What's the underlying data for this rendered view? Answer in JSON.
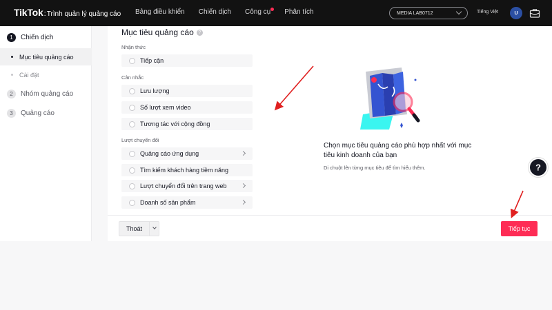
{
  "topbar": {
    "logo_main": "TikTok",
    "logo_colon": ":",
    "logo_sub": "Trình quản lý quảng cáo",
    "nav": [
      "Bảng điều khiển",
      "Chiến dịch",
      "Công cụ",
      "Phân tích"
    ],
    "account": "MEDIA LAB0712",
    "language": "Tiếng Việt",
    "avatar_initial": "U",
    "icons": {
      "account_dropdown": "chevron-down-icon",
      "briefcase": "briefcase-icon"
    },
    "notification_color": "#fe2c55"
  },
  "sidebar": {
    "steps": [
      {
        "num": "1",
        "label": "Chiến dịch"
      },
      {
        "num": "2",
        "label": "Nhóm quảng cáo"
      },
      {
        "num": "3",
        "label": "Quảng cáo"
      }
    ],
    "substeps": [
      {
        "label": "Mục tiêu quảng cáo"
      },
      {
        "label": "Cài đặt"
      }
    ]
  },
  "main": {
    "title": "Mục tiêu quảng cáo",
    "help_glyph": "?",
    "groups": {
      "awareness": "Nhận thức",
      "consideration": "Cân nhắc",
      "conversion": "Lượt chuyển đổi"
    },
    "options": {
      "reach": "Tiếp cận",
      "traffic": "Lưu lượng",
      "video_views": "Số lượt xem video",
      "community": "Tương tác với cộng đồng",
      "app_promotion": "Quảng cáo ứng dụng",
      "lead_gen": "Tìm kiếm khách hàng tiềm năng",
      "web_conversions": "Lượt chuyển đổi trên trang web",
      "product_sales": "Doanh số sản phẩm"
    },
    "promo_title": "Chọn mục tiêu quảng cáo phù hợp nhất với mục tiêu kinh doanh của bạn",
    "promo_sub": "Di chuột lên từng mục tiêu để tìm hiểu thêm.",
    "exit": "Thoát",
    "continue": "Tiếp tục"
  },
  "colors": {
    "accent": "#fe2c55",
    "annotation_arrow": "#e02020"
  }
}
